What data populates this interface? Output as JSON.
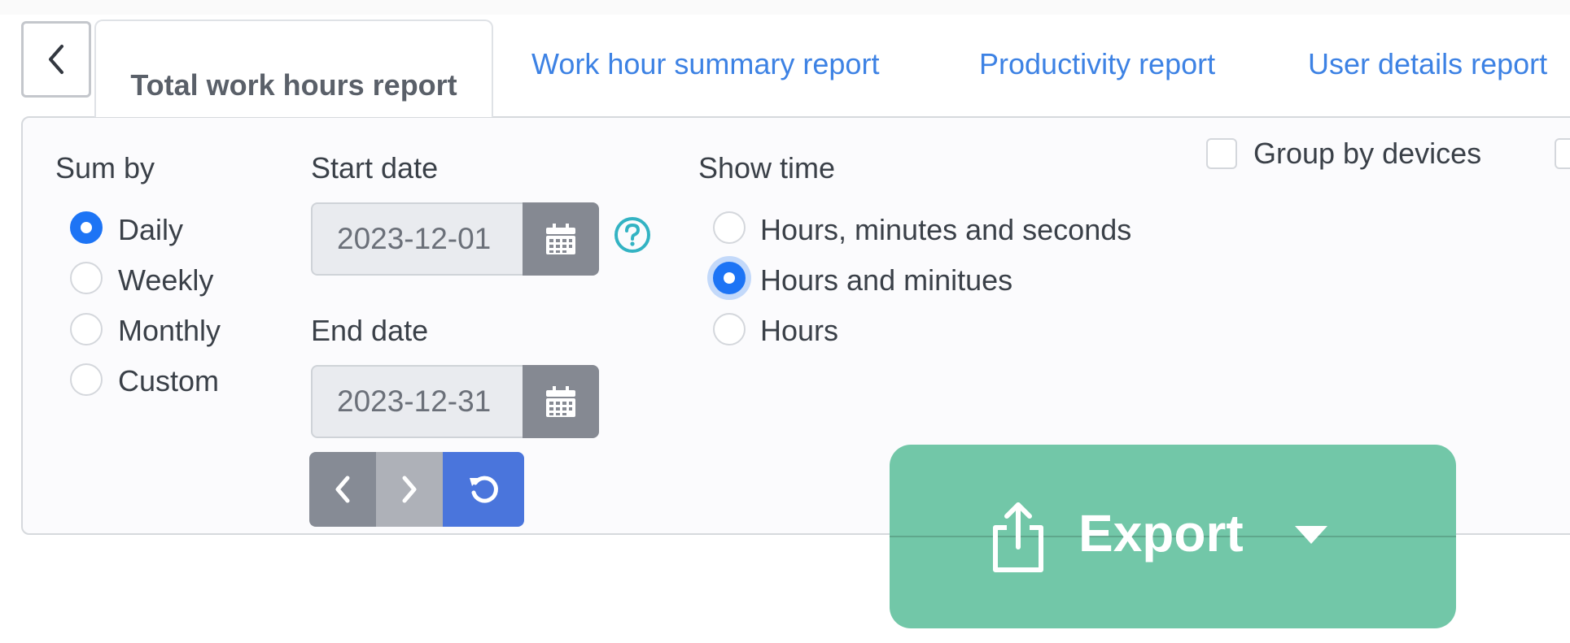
{
  "tabs": {
    "active": "Total work hours report",
    "links": [
      "Work hour summary report",
      "Productivity report",
      "User details report"
    ]
  },
  "sum_by": {
    "label": "Sum by",
    "options": [
      "Daily",
      "Weekly",
      "Monthly",
      "Custom"
    ],
    "selected": "Daily"
  },
  "dates": {
    "start_label": "Start date",
    "start_value": "2023-12-01",
    "end_label": "End date",
    "end_value": "2023-12-31"
  },
  "show_time": {
    "label": "Show time",
    "options": [
      "Hours, minutes and seconds",
      "Hours and minitues",
      "Hours"
    ],
    "selected": "Hours and minitues"
  },
  "group_by_devices": {
    "label": "Group by devices",
    "checked": false
  },
  "export": {
    "label": "Export"
  },
  "colors": {
    "accent_blue": "#1d74f5",
    "link_blue": "#3d82e4",
    "export_green": "#72c7a8",
    "reset_blue": "#4a75dc"
  }
}
